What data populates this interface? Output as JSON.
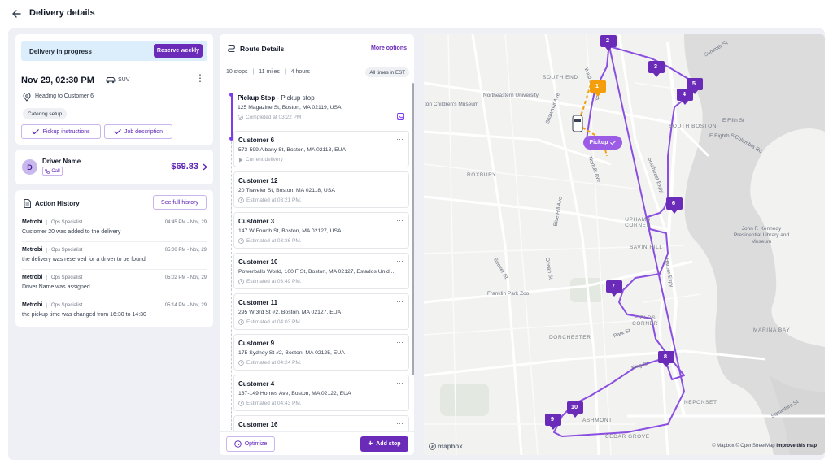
{
  "header": {
    "title": "Delivery details"
  },
  "delivery": {
    "banner_text": "Delivery in progress",
    "reserve_label": "Reserve weekly",
    "datetime": "Nov 29, 02:30 PM",
    "vehicle": "SUV",
    "heading_to": "Heading to Customer 6",
    "tag": "Catering setup",
    "pickup_instructions_label": "Pickup instructions",
    "job_description_label": "Job description"
  },
  "driver": {
    "initial": "D",
    "name": "Driver Name",
    "call_label": "Call",
    "price": "$69.83"
  },
  "history": {
    "title": "Action History",
    "full_history_label": "See full history",
    "items": [
      {
        "who": "Metrobi",
        "role": "Ops Specialist",
        "time": "04:45 PM - Nov, 29",
        "msg": "Customer 20 was added to the delivery"
      },
      {
        "who": "Metrobi",
        "role": "Ops Specialist",
        "time": "05:00 PM - Nov, 29",
        "msg": "the delivery was reserved for a driver to be found"
      },
      {
        "who": "Metrobi",
        "role": "Ops Specialist",
        "time": "05:02 PM - Nov, 29",
        "msg": "Driver Name was assigned"
      },
      {
        "who": "Metrobi",
        "role": "Ops Specialist",
        "time": "05:14 PM - Nov, 29",
        "msg": "the pickup time was changed from 16:30 to 14:30"
      }
    ]
  },
  "route": {
    "title": "Route Details",
    "more_options": "More options",
    "stops_count": "10 stops",
    "miles": "11 miles",
    "hours": "4 hours",
    "timezone": "All times in EST",
    "optimize_label": "Optimize",
    "add_stop_label": "Add stop",
    "stops": [
      {
        "name": "Pickup Stop",
        "sub": " - Pickup stop",
        "addr": "125 Magazine St, Boston, MA 02119, USA",
        "status": "Completed at 03:22 PM"
      },
      {
        "name": "Customer 6",
        "sub": "",
        "addr": "573-599 Albany St, Boston, MA 02118, EUA",
        "status": "Current delivery"
      },
      {
        "name": "Customer 12",
        "sub": "",
        "addr": "20 Traveler St, Boston, MA 02118, USA",
        "status": "Estimated at 03:21 PM."
      },
      {
        "name": "Customer 3",
        "sub": "",
        "addr": "147 W Fourth St, Boston, MA 02127, USA",
        "status": "Estimated at 03:36 PM."
      },
      {
        "name": "Customer 10",
        "sub": "",
        "addr": "Powerballs World, 100 F St, Boston, MA 02127, Estados Unid...",
        "status": "Estimated at 03:49 PM."
      },
      {
        "name": "Customer 11",
        "sub": "",
        "addr": "295 W 3rd St #2, Boston, MA 02127, EUA",
        "status": "Estimated at 04:03 PM."
      },
      {
        "name": "Customer 9",
        "sub": "",
        "addr": "175 Sydney St #2, Boston, MA 02125, EUA",
        "status": "Estimated at 04:24 PM."
      },
      {
        "name": "Customer 4",
        "sub": "",
        "addr": "137-149 Homes Ave, Boston, MA 02122, EUA",
        "status": "Estimated at 04:43 PM."
      },
      {
        "name": "Customer 16",
        "sub": "",
        "addr": "",
        "status": ""
      }
    ]
  },
  "map": {
    "labels": {
      "south_end": "SOUTH END",
      "northeastern": "Northeastern University",
      "childrens": "ton Children's Museum",
      "south_boston": "SOUTH BOSTON",
      "roxbury": "ROXBURY",
      "uphams": "UPHAMS CORNER",
      "savin": "SAVIN HILL",
      "jfk": "John F. Kennedy Presidential Library and Museum",
      "franklin": "Franklin Park Zoo",
      "dorchester": "DORCHESTER",
      "fields": "FIELDS CORNER",
      "marina": "MARINA BAY",
      "neponset": "NEPONSET",
      "ashmont": "ASHMONT",
      "cedar": "CEDAR GROVE",
      "summer": "Summer St",
      "e_fifth": "E Fifth St",
      "e_eighth": "E Eighth St",
      "columbia": "Columbia Rd",
      "southeast": "Southeast Expy",
      "blue_hill": "Blue Hill Ave",
      "seaver": "Seaver St",
      "park": "Park St",
      "king": "King St",
      "washington": "Washington St",
      "shawmut": "Shawmut Ave",
      "norfolk": "Norfolk Ave",
      "ocean": "Ocean St",
      "squantum": "Squantum St",
      "harbor": "Harbor Expy"
    },
    "pickup_tag": "Pickup",
    "markers": [
      "2",
      "3",
      "5",
      "4",
      "1",
      "6",
      "7",
      "8",
      "10",
      "9"
    ],
    "mapbox": "mapbox",
    "attribution": "© Mapbox © OpenStreetMap",
    "improve": "Improve this map"
  },
  "colors": {
    "accent": "#6a2bb8",
    "route": "#8a4fe0",
    "pickup": "#f59e0b",
    "banner": "#dceefb"
  }
}
